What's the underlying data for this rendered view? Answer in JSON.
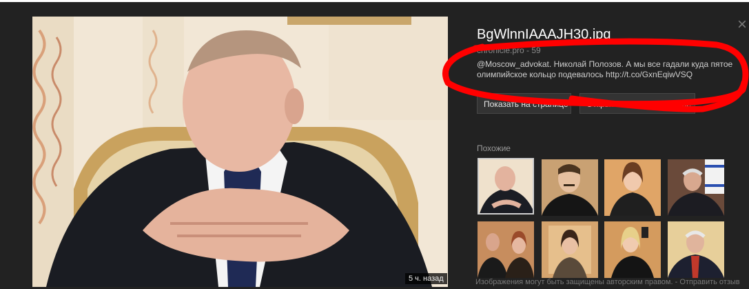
{
  "preview": {
    "time_badge": "5 ч. назад"
  },
  "info": {
    "close_glyph": "×",
    "file_title": "BgWlnnIAAAJH30.jpg",
    "source_line": "chronicle.pro - 59",
    "description": "@Moscow_advokat. Николай Полозов. А мы все гадали куда пятое олимпийское кольцо подевалось http://t.co/GxnEqiwVSQ",
    "buttons": {
      "show_on_page": "Показать на странице",
      "full_size": "Открыть в полном размере"
    }
  },
  "similar": {
    "heading": "Похожие",
    "thumbnails": [
      {
        "subject": "man in suit, hands clasped",
        "selected": true
      },
      {
        "subject": "young man with moustache"
      },
      {
        "subject": "woman smiling"
      },
      {
        "subject": "older man with flag"
      },
      {
        "subject": "couple at event"
      },
      {
        "subject": "woman portrait"
      },
      {
        "subject": "woman selfie"
      },
      {
        "subject": "older man in suit"
      }
    ]
  },
  "footer": {
    "notice": "Изображения могут быть защищены авторским правом. -  Отправить отзыв"
  },
  "colors": {
    "background": "#222222",
    "scribble": "#ff0000",
    "button_bg": "#333333"
  }
}
